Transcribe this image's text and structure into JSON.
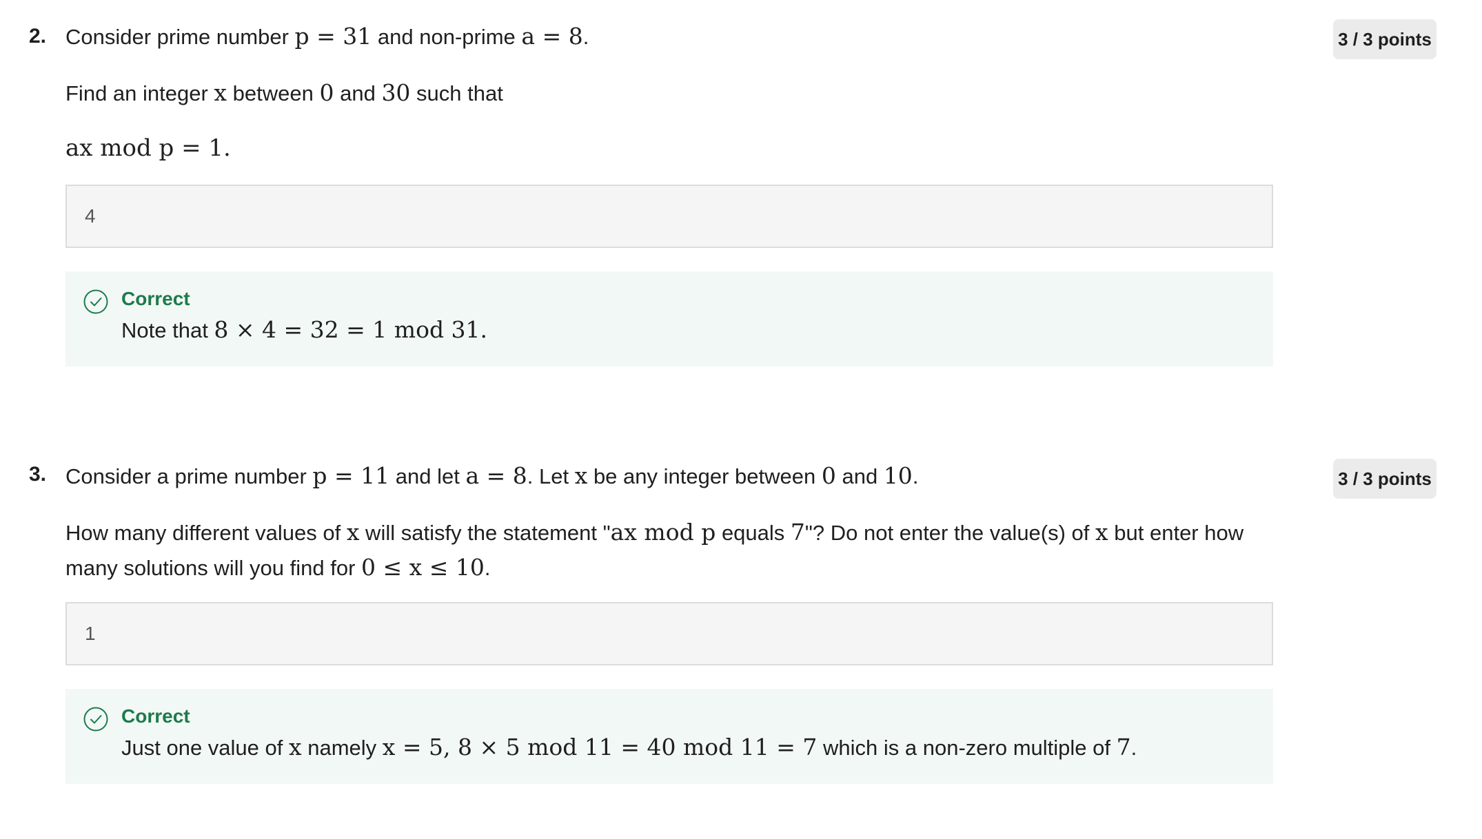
{
  "questions": [
    {
      "number": "2.",
      "points": "3 / 3 points",
      "intro": {
        "t1": "Consider prime number ",
        "m1": "p = 31",
        "t2": " and non-prime ",
        "m2": "a = 8",
        "t3": "."
      },
      "prompt": {
        "t1": "Find an integer ",
        "m1": "x",
        "t2": " between ",
        "m2": "0",
        "t3": " and ",
        "m3": "30",
        "t4": " such that"
      },
      "equation": "ax  mod p = 1.",
      "answer": "4",
      "feedback": {
        "status": "Correct",
        "t1": "Note that ",
        "m1": "8 × 4 = 32 = 1  mod 31."
      }
    },
    {
      "number": "3.",
      "points": "3 / 3 points",
      "intro": {
        "t1": "Consider a prime number ",
        "m1": "p = 11",
        "t2": " and let ",
        "m2": "a = 8",
        "t3": ". Let ",
        "m3": "x",
        "t4": " be any integer between ",
        "m4": "0",
        "t5": " and ",
        "m5": "10",
        "t6": "."
      },
      "prompt": {
        "t1": "How many different values of ",
        "m1": "x",
        "t2": " will satisfy the statement \"",
        "m2": "ax  mod p",
        "t3": " equals ",
        "m3": "7",
        "t4": "\"? Do not enter the value(s) of ",
        "m4": "x",
        "t5": " but enter how many solutions will you find for ",
        "m5": "0 ≤ x ≤ 10",
        "t6": "."
      },
      "answer": "1",
      "feedback": {
        "status": "Correct",
        "t1": "Just  one value of ",
        "m1": "x",
        "t2": " namely ",
        "m2": "x = 5, 8 × 5  mod 11 = 40  mod 11 = 7",
        "t3": " which is a non-zero multiple of ",
        "m3": "7",
        "t4": "."
      }
    }
  ],
  "colors": {
    "correct_green": "#1e7a4c",
    "feedback_bg": "#f2f8f5",
    "answer_bg": "#f5f5f5",
    "badge_bg": "#ebebeb"
  },
  "icons": {
    "feedback_status": "check-circle-icon"
  }
}
